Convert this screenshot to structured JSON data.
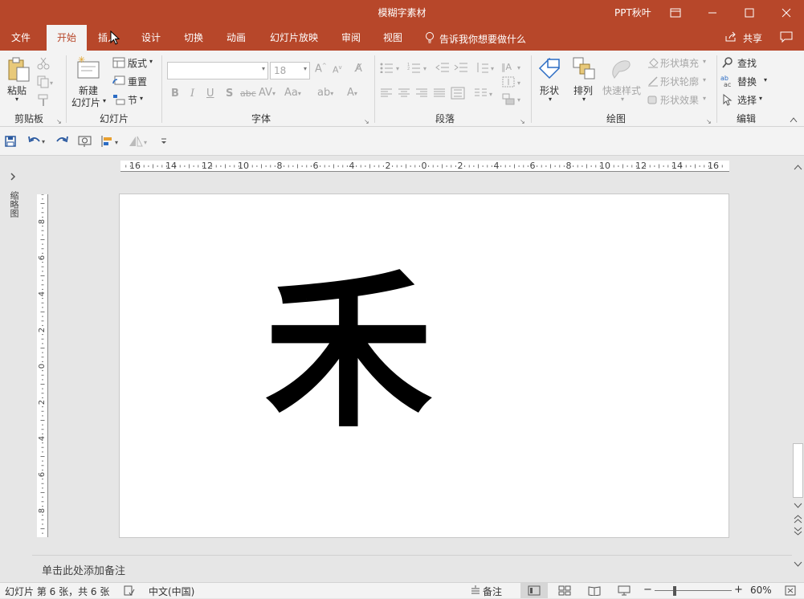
{
  "window": {
    "title": "模糊字素材",
    "user": "PPT秋叶"
  },
  "tabs": [
    {
      "label": "文件"
    },
    {
      "label": "开始"
    },
    {
      "label": "插入"
    },
    {
      "label": "设计"
    },
    {
      "label": "切换"
    },
    {
      "label": "动画"
    },
    {
      "label": "幻灯片放映"
    },
    {
      "label": "审阅"
    },
    {
      "label": "视图"
    }
  ],
  "tell_me": "告诉我你想要做什么",
  "share": "共享",
  "ribbon": {
    "clipboard": {
      "paste": "粘贴",
      "label": "剪贴板"
    },
    "slides": {
      "new_slide_1": "新建",
      "new_slide_2": "幻灯片",
      "layout": "版式",
      "reset": "重置",
      "section": "节",
      "label": "幻灯片"
    },
    "font": {
      "size": "18",
      "label": "字体"
    },
    "paragraph": {
      "label": "段落"
    },
    "drawing": {
      "shape": "形状",
      "arrange": "排列",
      "quick_style": "快速样式",
      "fill": "形状填充",
      "outline": "形状轮廓",
      "effect": "形状效果",
      "label": "绘图"
    },
    "editing": {
      "find": "查找",
      "replace": "替换",
      "select": "选择",
      "label": "编辑"
    }
  },
  "left_pane": {
    "label": "缩略图"
  },
  "ruler": {
    "h_ticks": [
      "16",
      "14",
      "12",
      "10",
      "8",
      "6",
      "4",
      "2",
      "0",
      "2",
      "4",
      "6",
      "8",
      "10",
      "12",
      "14",
      "16"
    ],
    "v_ticks": [
      "8",
      "6",
      "4",
      "2",
      "0",
      "2",
      "4",
      "6",
      "8"
    ]
  },
  "slide": {
    "glyph": "禾"
  },
  "notes": {
    "placeholder": "单击此处添加备注"
  },
  "status": {
    "slide_info": "幻灯片 第 6 张，共 6 张",
    "language": "中文(中国)",
    "notes_btn": "备注",
    "zoom": "60%"
  }
}
